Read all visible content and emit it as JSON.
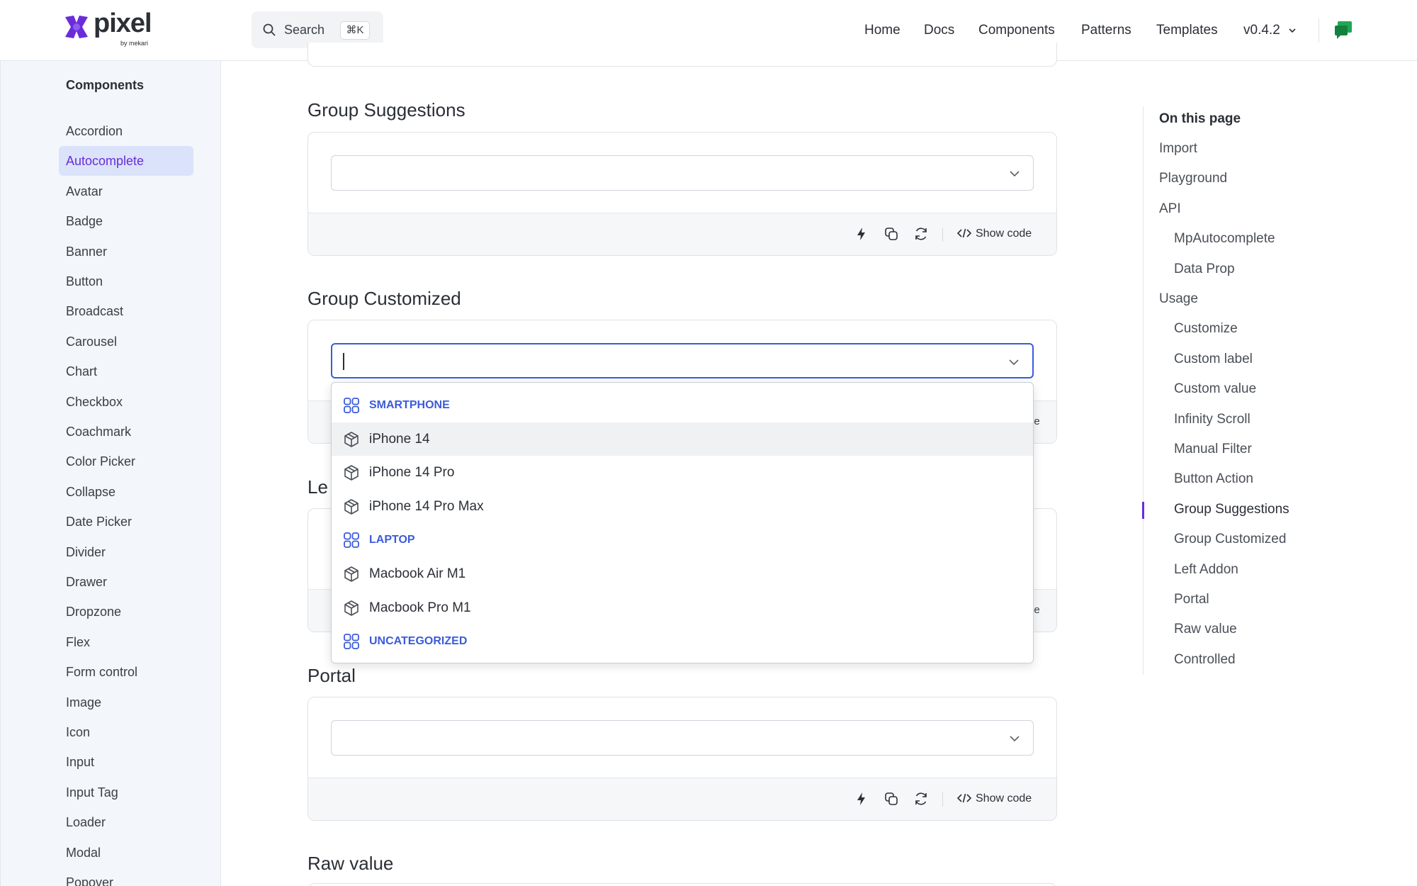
{
  "header": {
    "logo_text": "pixel",
    "logo_sub": "by mekari",
    "search_label": "Search",
    "search_shortcut": "⌘K",
    "nav": [
      "Home",
      "Docs",
      "Components",
      "Patterns",
      "Templates"
    ],
    "version": "v0.4.2"
  },
  "sidebar": {
    "title": "Components",
    "items": [
      "Accordion",
      "Autocomplete",
      "Avatar",
      "Badge",
      "Banner",
      "Button",
      "Broadcast",
      "Carousel",
      "Chart",
      "Checkbox",
      "Coachmark",
      "Color Picker",
      "Collapse",
      "Date Picker",
      "Divider",
      "Drawer",
      "Dropzone",
      "Flex",
      "Form control",
      "Image",
      "Icon",
      "Input",
      "Input Tag",
      "Loader",
      "Modal",
      "Popover"
    ],
    "active": "Autocomplete"
  },
  "main": {
    "sections": [
      {
        "title": "Group Suggestions"
      },
      {
        "title": "Group Customized"
      },
      {
        "title": "Left Addon",
        "visible_fragment": "Le"
      },
      {
        "title": "Portal"
      },
      {
        "title": "Raw value"
      }
    ],
    "show_code_label": "Show code",
    "cut_fragment": "de"
  },
  "dropdown": {
    "rows": [
      {
        "type": "group",
        "label": "SMARTPHONE",
        "icon": "group-grid-icon"
      },
      {
        "type": "option",
        "label": "iPhone 14",
        "icon": "box-icon",
        "hover": true
      },
      {
        "type": "option",
        "label": "iPhone 14 Pro",
        "icon": "box-icon"
      },
      {
        "type": "option",
        "label": "iPhone 14 Pro Max",
        "icon": "box-icon"
      },
      {
        "type": "group",
        "label": "LAPTOP",
        "icon": "group-grid-icon"
      },
      {
        "type": "option",
        "label": "Macbook Air M1",
        "icon": "box-icon"
      },
      {
        "type": "option",
        "label": "Macbook Pro M1",
        "icon": "box-icon"
      },
      {
        "type": "group",
        "label": "UNCATEGORIZED",
        "icon": "group-grid-icon"
      }
    ]
  },
  "toc": {
    "title": "On this page",
    "items": [
      {
        "label": "Import",
        "level": 1
      },
      {
        "label": "Playground",
        "level": 1
      },
      {
        "label": "API",
        "level": 1
      },
      {
        "label": "MpAutocomplete",
        "level": 2
      },
      {
        "label": "Data Prop",
        "level": 2
      },
      {
        "label": "Usage",
        "level": 1
      },
      {
        "label": "Customize",
        "level": 2
      },
      {
        "label": "Custom label",
        "level": 2
      },
      {
        "label": "Custom value",
        "level": 2
      },
      {
        "label": "Infinity Scroll",
        "level": 2
      },
      {
        "label": "Manual Filter",
        "level": 2
      },
      {
        "label": "Button Action",
        "level": 2
      },
      {
        "label": "Group Suggestions",
        "level": 2
      },
      {
        "label": "Group Customized",
        "level": 2
      },
      {
        "label": "Left Addon",
        "level": 2
      },
      {
        "label": "Portal",
        "level": 2
      },
      {
        "label": "Raw value",
        "level": 2
      },
      {
        "label": "Controlled",
        "level": 2
      }
    ],
    "active": "Group Suggestions"
  },
  "colors": {
    "accent": "#6a2cd8",
    "link_blue": "#3b5bd9",
    "sidebar_bg": "#f3f6fa",
    "active_bg": "#dbe3fb",
    "chat_green": "#1fa855"
  }
}
